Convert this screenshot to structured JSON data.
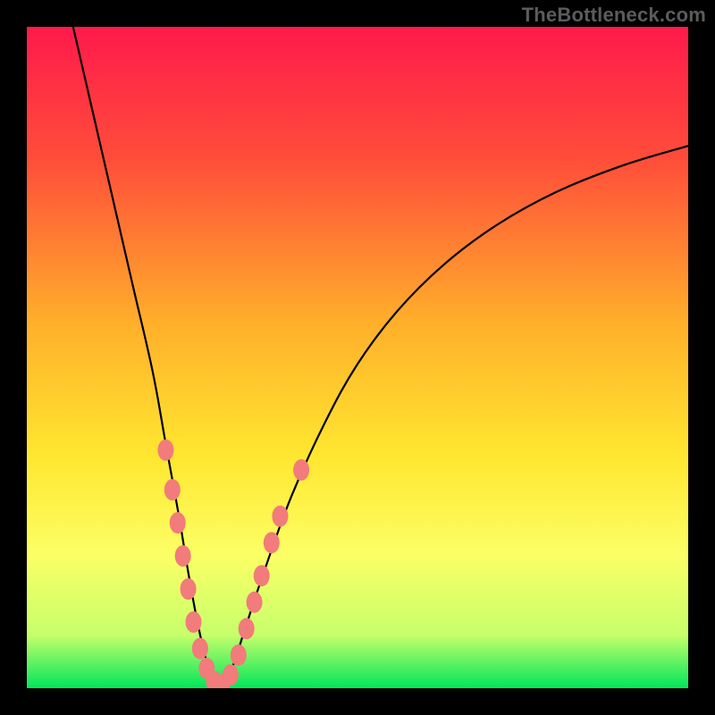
{
  "watermark": "TheBottleneck.com",
  "chart_data": {
    "type": "line",
    "title": "",
    "xlabel": "",
    "ylabel": "",
    "xlim": [
      0,
      100
    ],
    "ylim": [
      0,
      100
    ],
    "grid": false,
    "legend": false,
    "gradient_stops": [
      {
        "offset": 0.0,
        "color": "#ff1a4b"
      },
      {
        "offset": 0.2,
        "color": "#ff4d3a"
      },
      {
        "offset": 0.45,
        "color": "#ffb02a"
      },
      {
        "offset": 0.65,
        "color": "#ffe730"
      },
      {
        "offset": 0.8,
        "color": "#fbff66"
      },
      {
        "offset": 0.92,
        "color": "#c6ff6b"
      },
      {
        "offset": 1.0,
        "color": "#00e65a"
      }
    ],
    "series": [
      {
        "name": "bottleneck-curve",
        "x": [
          7,
          10,
          13,
          16,
          19,
          21,
          23,
          24.5,
          26,
          27.5,
          29,
          31,
          33,
          36,
          40,
          45,
          50,
          56,
          63,
          71,
          80,
          90,
          100
        ],
        "y": [
          100,
          87,
          74,
          61,
          48,
          37,
          26,
          17,
          9,
          3,
          0,
          3,
          9,
          18,
          29,
          40,
          49,
          57,
          64,
          70,
          75,
          79,
          82
        ]
      }
    ],
    "markers": [
      {
        "x": 21.0,
        "y": 36
      },
      {
        "x": 22.0,
        "y": 30
      },
      {
        "x": 22.8,
        "y": 25
      },
      {
        "x": 23.6,
        "y": 20
      },
      {
        "x": 24.4,
        "y": 15
      },
      {
        "x": 25.2,
        "y": 10
      },
      {
        "x": 26.2,
        "y": 6
      },
      {
        "x": 27.2,
        "y": 3
      },
      {
        "x": 28.3,
        "y": 1
      },
      {
        "x": 29.5,
        "y": 0.5
      },
      {
        "x": 30.8,
        "y": 2
      },
      {
        "x": 32.0,
        "y": 5
      },
      {
        "x": 33.2,
        "y": 9
      },
      {
        "x": 34.4,
        "y": 13
      },
      {
        "x": 35.5,
        "y": 17
      },
      {
        "x": 37.0,
        "y": 22
      },
      {
        "x": 38.3,
        "y": 26
      },
      {
        "x": 41.5,
        "y": 33
      }
    ],
    "marker_color": "#f27b7b",
    "curve_color": "#000000"
  }
}
